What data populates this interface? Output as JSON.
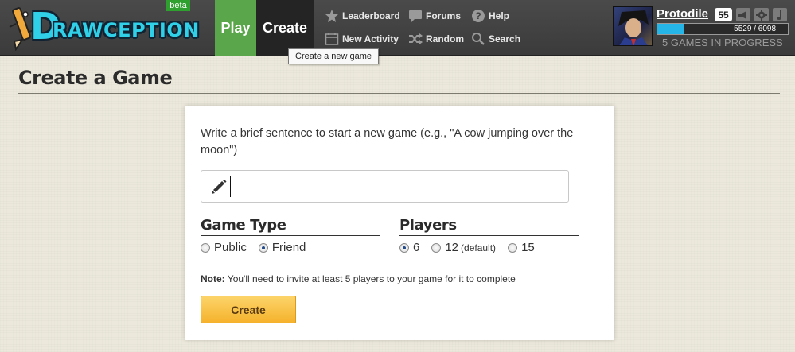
{
  "header": {
    "logo_text": "RAWCEPTION",
    "logo_initial": "D",
    "beta_label": "beta",
    "play_label": "Play",
    "create_label": "Create",
    "links": {
      "leaderboard": "Leaderboard",
      "forums": "Forums",
      "help": "Help",
      "new_activity": "New Activity",
      "random": "Random",
      "search": "Search"
    },
    "tooltip": "Create a new game",
    "user": {
      "name": "Protodile",
      "level": "55",
      "xp_text": "5529 / 6098",
      "xp_fraction": 0.2,
      "games_in_progress": "5 GAMES IN PROGRESS"
    }
  },
  "page": {
    "title": "Create a Game"
  },
  "form": {
    "prompt": "Write a brief sentence to start a new game (e.g., \"A cow jumping over the moon\")",
    "sentence_value": "",
    "game_type": {
      "title": "Game Type",
      "options": [
        "Public",
        "Friend"
      ],
      "selected": "Friend"
    },
    "players": {
      "title": "Players",
      "options": [
        "6",
        "12",
        "15"
      ],
      "default_note": "(default)",
      "selected": "6"
    },
    "note_label": "Note:",
    "note_text": " You'll need to invite at least 5 players to your game for it to complete",
    "create_button": "Create"
  },
  "colors": {
    "topbar": "#3f3f3f",
    "play_tab": "#5aa64a",
    "create_tab": "#242424",
    "logo": "#2fd0e8",
    "xp_fill": "#25b5e6",
    "button": "#f5b22c"
  }
}
